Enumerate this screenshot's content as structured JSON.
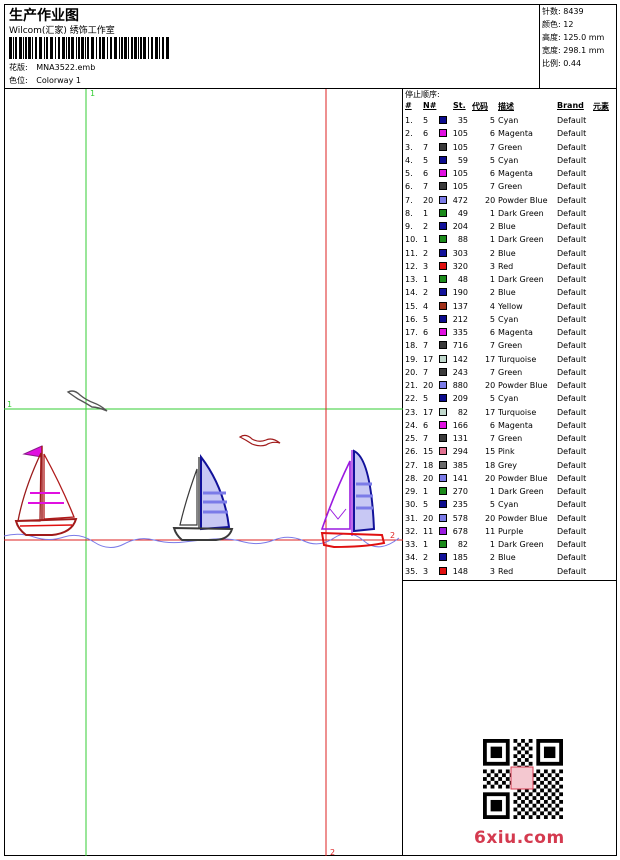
{
  "header": {
    "title": "生产作业图",
    "company": "Wilcom(汇家) 绣饰工作室",
    "design_label": "花版:",
    "design_value": "MNA3522.emb",
    "color_label": "色位:",
    "color_value": "Colorway 1"
  },
  "stats": {
    "stitches_label": "针数:",
    "stitches_value": "8439",
    "colors_label": "颜色:",
    "colors_value": "12",
    "height_label": "高度:",
    "height_value": "125.0 mm",
    "width_label": "宽度:",
    "width_value": "298.1 mm",
    "scale_label": "比例:",
    "scale_value": "0.44"
  },
  "markers": {
    "top": "1",
    "left": "1",
    "bottom": "2",
    "right": "2"
  },
  "table": {
    "title": "停止顺序:",
    "headers": {
      "num": "#",
      "no": "N#",
      "st": "St.",
      "code": "代码",
      "desc": "描述",
      "brand": "Brand",
      "elem": "元素"
    },
    "rows": [
      {
        "idx": "1.",
        "n": "5",
        "st": "35",
        "code": "5",
        "desc": "Cyan",
        "brand": "Default",
        "color": "#0b0b8c"
      },
      {
        "idx": "2.",
        "n": "6",
        "st": "105",
        "code": "6",
        "desc": "Magenta",
        "brand": "Default",
        "color": "#e010e0"
      },
      {
        "idx": "3.",
        "n": "7",
        "st": "105",
        "code": "7",
        "desc": "Green",
        "brand": "Default",
        "color": "#3a3a3a"
      },
      {
        "idx": "4.",
        "n": "5",
        "st": "59",
        "code": "5",
        "desc": "Cyan",
        "brand": "Default",
        "color": "#0b0b8c"
      },
      {
        "idx": "5.",
        "n": "6",
        "st": "105",
        "code": "6",
        "desc": "Magenta",
        "brand": "Default",
        "color": "#e010e0"
      },
      {
        "idx": "6.",
        "n": "7",
        "st": "105",
        "code": "7",
        "desc": "Green",
        "brand": "Default",
        "color": "#3a3a3a"
      },
      {
        "idx": "7.",
        "n": "20",
        "st": "472",
        "code": "20",
        "desc": "Powder Blue",
        "brand": "Default",
        "color": "#7b7be8"
      },
      {
        "idx": "8.",
        "n": "1",
        "st": "49",
        "code": "1",
        "desc": "Dark Green",
        "brand": "Default",
        "color": "#1a8a1a"
      },
      {
        "idx": "9.",
        "n": "2",
        "st": "204",
        "code": "2",
        "desc": "Blue",
        "brand": "Default",
        "color": "#12129a"
      },
      {
        "idx": "10.",
        "n": "1",
        "st": "88",
        "code": "1",
        "desc": "Dark Green",
        "brand": "Default",
        "color": "#1a8a1a"
      },
      {
        "idx": "11.",
        "n": "2",
        "st": "303",
        "code": "2",
        "desc": "Blue",
        "brand": "Default",
        "color": "#12129a"
      },
      {
        "idx": "12.",
        "n": "3",
        "st": "320",
        "code": "3",
        "desc": "Red",
        "brand": "Default",
        "color": "#e01010"
      },
      {
        "idx": "13.",
        "n": "1",
        "st": "48",
        "code": "1",
        "desc": "Dark Green",
        "brand": "Default",
        "color": "#1a8a1a"
      },
      {
        "idx": "14.",
        "n": "2",
        "st": "190",
        "code": "2",
        "desc": "Blue",
        "brand": "Default",
        "color": "#12129a"
      },
      {
        "idx": "15.",
        "n": "4",
        "st": "137",
        "code": "4",
        "desc": "Yellow",
        "brand": "Default",
        "color": "#a0301a"
      },
      {
        "idx": "16.",
        "n": "5",
        "st": "212",
        "code": "5",
        "desc": "Cyan",
        "brand": "Default",
        "color": "#0b0b8c"
      },
      {
        "idx": "17.",
        "n": "6",
        "st": "335",
        "code": "6",
        "desc": "Magenta",
        "brand": "Default",
        "color": "#e010e0"
      },
      {
        "idx": "18.",
        "n": "7",
        "st": "716",
        "code": "7",
        "desc": "Green",
        "brand": "Default",
        "color": "#3a3a3a"
      },
      {
        "idx": "19.",
        "n": "17",
        "st": "142",
        "code": "17",
        "desc": "Turquoise",
        "brand": "Default",
        "color": "#c0d8cc"
      },
      {
        "idx": "20.",
        "n": "7",
        "st": "243",
        "code": "7",
        "desc": "Green",
        "brand": "Default",
        "color": "#3a3a3a"
      },
      {
        "idx": "21.",
        "n": "20",
        "st": "880",
        "code": "20",
        "desc": "Powder Blue",
        "brand": "Default",
        "color": "#7b7be8"
      },
      {
        "idx": "22.",
        "n": "5",
        "st": "209",
        "code": "5",
        "desc": "Cyan",
        "brand": "Default",
        "color": "#0b0b8c"
      },
      {
        "idx": "23.",
        "n": "17",
        "st": "82",
        "code": "17",
        "desc": "Turquoise",
        "brand": "Default",
        "color": "#c0d8cc"
      },
      {
        "idx": "24.",
        "n": "6",
        "st": "166",
        "code": "6",
        "desc": "Magenta",
        "brand": "Default",
        "color": "#e010e0"
      },
      {
        "idx": "25.",
        "n": "7",
        "st": "131",
        "code": "7",
        "desc": "Green",
        "brand": "Default",
        "color": "#3a3a3a"
      },
      {
        "idx": "26.",
        "n": "15",
        "st": "294",
        "code": "15",
        "desc": "Pink",
        "brand": "Default",
        "color": "#e07090"
      },
      {
        "idx": "27.",
        "n": "18",
        "st": "385",
        "code": "18",
        "desc": "Grey",
        "brand": "Default",
        "color": "#6a6a6a"
      },
      {
        "idx": "28.",
        "n": "20",
        "st": "141",
        "code": "20",
        "desc": "Powder Blue",
        "brand": "Default",
        "color": "#7b7be8"
      },
      {
        "idx": "29.",
        "n": "1",
        "st": "270",
        "code": "1",
        "desc": "Dark Green",
        "brand": "Default",
        "color": "#1a8a1a"
      },
      {
        "idx": "30.",
        "n": "5",
        "st": "235",
        "code": "5",
        "desc": "Cyan",
        "brand": "Default",
        "color": "#0b0b8c"
      },
      {
        "idx": "31.",
        "n": "20",
        "st": "578",
        "code": "20",
        "desc": "Powder Blue",
        "brand": "Default",
        "color": "#7b7be8"
      },
      {
        "idx": "32.",
        "n": "11",
        "st": "678",
        "code": "11",
        "desc": "Purple",
        "brand": "Default",
        "color": "#9a1ae0"
      },
      {
        "idx": "33.",
        "n": "1",
        "st": "82",
        "code": "1",
        "desc": "Dark Green",
        "brand": "Default",
        "color": "#1a8a1a"
      },
      {
        "idx": "34.",
        "n": "2",
        "st": "185",
        "code": "2",
        "desc": "Blue",
        "brand": "Default",
        "color": "#12129a"
      },
      {
        "idx": "35.",
        "n": "3",
        "st": "148",
        "code": "3",
        "desc": "Red",
        "brand": "Default",
        "color": "#e01010"
      }
    ]
  },
  "watermark": {
    "text": "6xiu.com",
    "color": "#d43a4f"
  },
  "guide_colors": {
    "start": "#33cc33",
    "end": "#dd2222"
  }
}
